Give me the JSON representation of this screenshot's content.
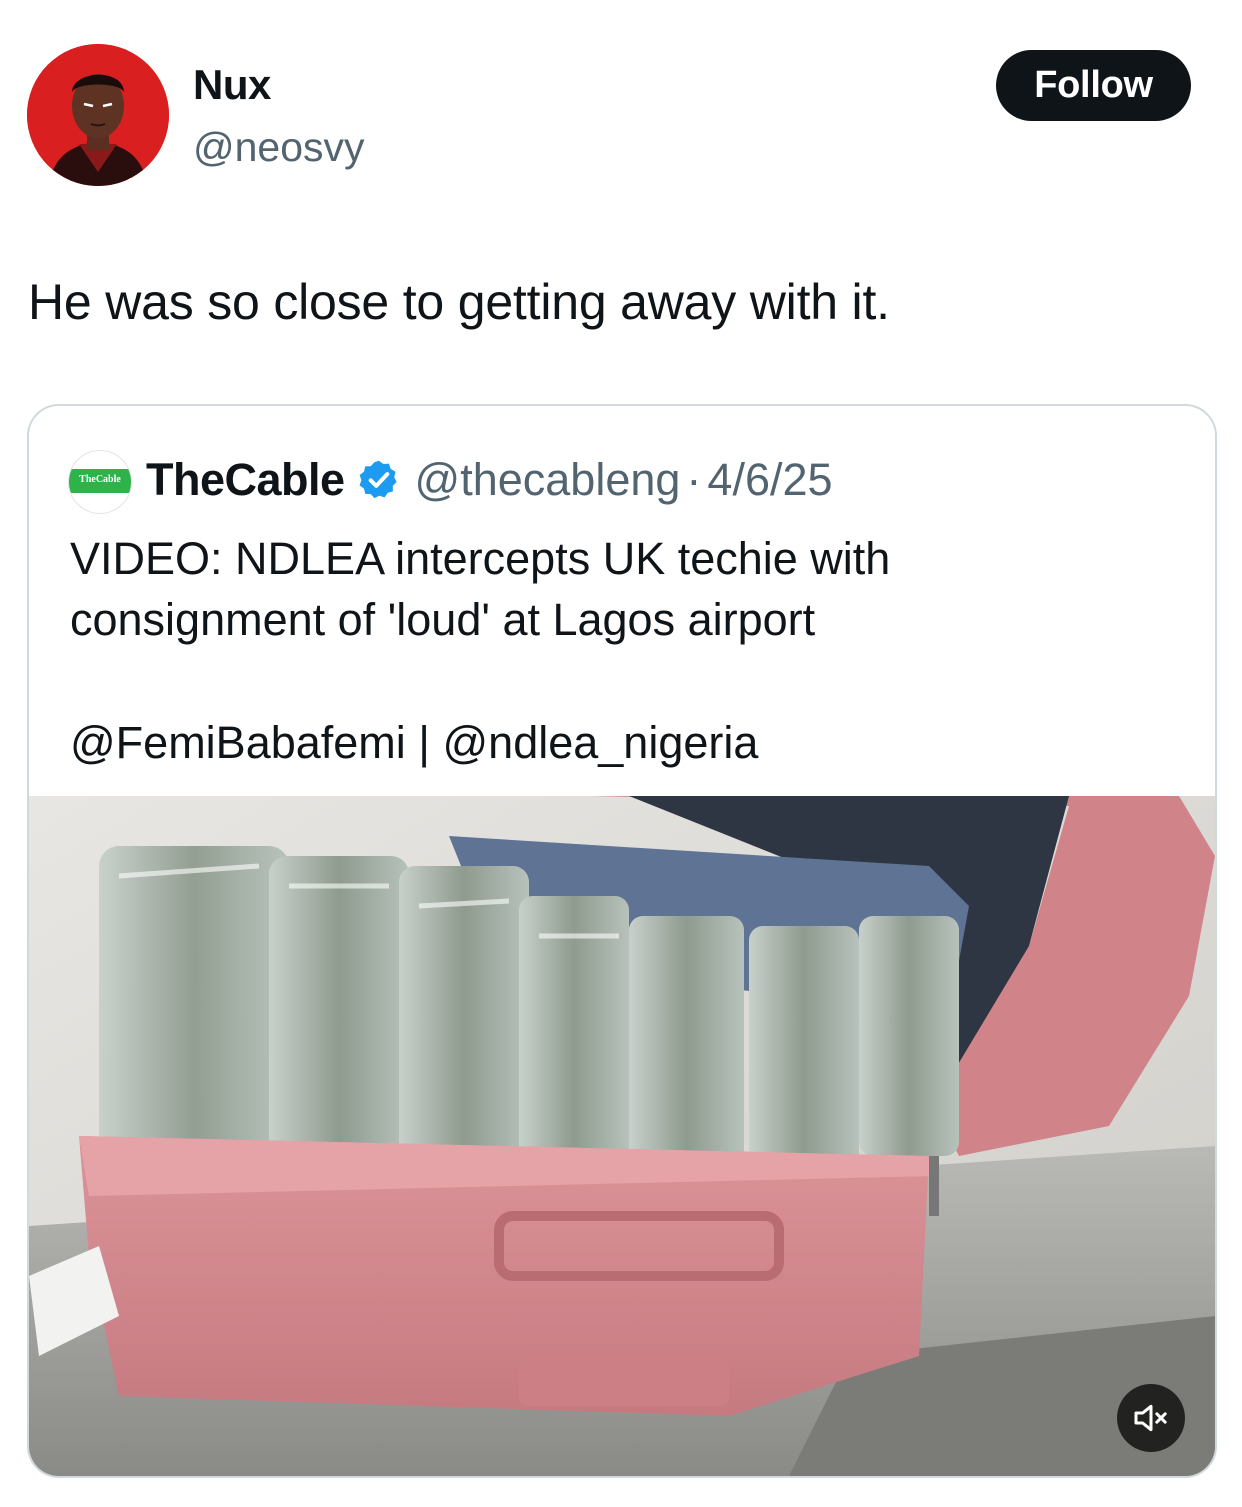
{
  "post": {
    "author": {
      "display_name": "Nux",
      "handle": "@neosvy",
      "avatar_icon": "illustrated-portrait-avatar"
    },
    "follow_label": "Follow",
    "text": "He was so close to getting away with it."
  },
  "quoted_post": {
    "author": {
      "display_name": "TheCable",
      "handle": "@thecableng",
      "avatar_logo_text": "TheCable",
      "verified_icon": "verified-badge-icon"
    },
    "separator": "·",
    "date": "4/6/25",
    "text_line1": "VIDEO: NDLEA intercepts UK techie with",
    "text_line2": "consignment of 'loud' at Lagos airport",
    "mentions": "@FemiBabafemi | @ndlea_nigeria",
    "media": {
      "type": "video",
      "mute_icon": "volume-muted-icon"
    }
  },
  "colors": {
    "follow_bg": "#0f1419",
    "handle_text": "#536471",
    "verified": "#1d9bf0",
    "card_border": "#cfd9de",
    "avatar_bg": "#d91f1f",
    "thecable_green": "#2db34a",
    "suitcase_pink": "#d9898d"
  }
}
